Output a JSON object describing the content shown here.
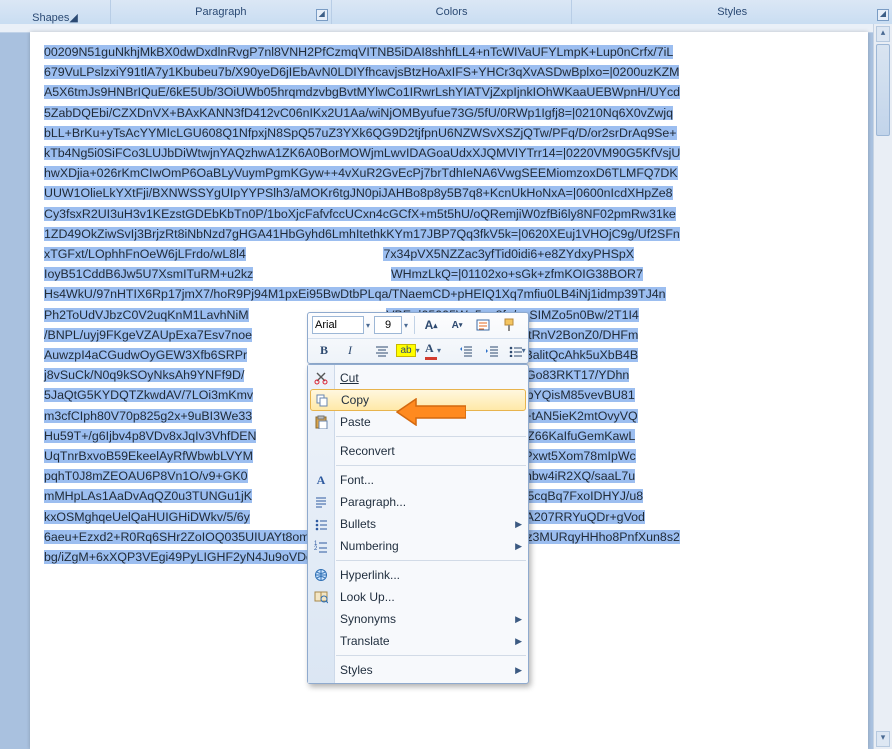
{
  "ribbon": {
    "group_left_partial": "Shapes",
    "group_paragraph": "Paragraph",
    "group_colors": "Colors",
    "group_styles": "Styles"
  },
  "mini_toolbar": {
    "font_name": "Arial",
    "font_size": "9",
    "grow_font": "A",
    "shrink_font": "A",
    "bold": "B",
    "italic": "I"
  },
  "context_menu": {
    "cut": "Cut",
    "copy": "Copy",
    "paste": "Paste",
    "reconvert": "Reconvert",
    "font": "Font...",
    "paragraph": "Paragraph...",
    "bullets": "Bullets",
    "numbering": "Numbering",
    "hyperlink": "Hyperlink...",
    "lookup": "Look Up...",
    "synonyms": "Synonyms",
    "translate": "Translate",
    "styles": "Styles"
  },
  "document_lines": [
    "00209N51guNkhjMkBX0dwDxdlnRvgP7nl8VNH2PfCzmqVITNB5iDAI8shhfLL4+nTcWIVaUFYLmpK+Lup0nCrfx/7iL",
    "679VuLPslzxiY91tlA7y1Kbubeu7b/X90yeD6jIEbAvN0LDIYfhcavjsBtzHoAxIFS+YHCr3qXvASDwBplxo=|0200uzKZM",
    "A5X6tmJs9HNBrIQuE/6kE5Ub/3OiUWb05hrqmdzvbgBvtMYlwCo1IRwrLshYIATVjZxpIjnkIOhWKaaUEBWpnH/UYcd",
    "5ZabDQEbi/CZXDnVX+BAxKANN3fD412vC06nIKx2U1Aa/wiNjOMByufue73G/5fU/0RWp1Igfj8=|0210Nq6X0vZwjq",
    "bLL+BrKu+yTsAcYYMIcLGU608Q1NfpxjN8SpQ57uZ3YXk6QG9D2tjfpnU6NZWSvXSZjQTw/PFq/D/or2srDrAq9Se+",
    "kTb4Ng5i0SiFCo3LUJbDiWtwjnYAQzhwA1ZK6A0BorMOWjmLwvIDAGoaUdxXJQMVIYTrr14=|0220VM90G5KfVsjU",
    "hwXDjia+026rKmCIwOmP6OaBLyVuymPgmKGyw++4vXuR2GvEcPj7brTdhIeNA6VwgSEEMiomzoxD6TLMFQ7DK",
    "UUW1OlieLkYXtFji/BXNWSSYgUIpYYPSlh3/aMOKr6tgJN0piJAHBo8p8y5B7q8+KcnUkHoNxA=|0600nIcdXHpZe8",
    "Cy3fsxR2UI3uH3v1KEzstGDEbKbTn0P/1boXjcFafvfccUCxn4cGCfX+m5t5hU/oQRemjiW0zfBi6ly8NF02pmRw31ke",
    "1ZD49OkZiwSvIj3BrjzRt8iNbNzd7gHGA41HbGyhd6LmhItethkKYm17JBP7Qq3fkV5k=|0620XEuj1VHOjC9g/Uf2SFn",
    "xTGFxt/LOphhFnOeW6jLFrdo/wL8l4{GAP}7x34pVX5NZZac3yfTid0idi6+e8ZYdxyPHSpX",
    "IoyB51CddB6Jw5U7XsmITuRM+u2kz{GAP}WHmzLkQ=|01102xo+sGk+zfmKOIG38BOR7",
    "Hs4WkU/97nHTIX6Rp17jmX7/hoR9Pj94M1pxEi95BwDtbPLqa/TNaemCD+pHEIQ1Xq7mfiu0LB4iNj1idmp39TJ4n",
    "Ph2ToUdVJbzC0V2uqKnM1LavhNiM{GAP}VBE=|05005W+5qg8fg/soSIMZo5n0Bw/2T1I4",
    "/BNPL/uyj9FKgeVZAUpExa7Esv7noe{GAP}jLv7yPbUx8I37jcPBrQ8HtRnV2BonZ0/DHFm",
    "AuwzpI4aCGudwOyGEW3Xfb6SRPr{GAP}JiY=|0800IAhH+UnnaXStBalitQcAhk5uXbB4B",
    "j8vSuCk/N0q9kSOyNksAh9YNFf9D/{GAP}grxwmU/NFHIrpW/WLFbhGo83RKT17/YDhn",
    "5JaQtG5KYDQTZkwdAV/7LOi3mKmv{GAP}=|0210ywTXSSZEICXhubYQisM85vevBU81",
    "m3cfCIph80V70p825g2x+9uBI3We33{GAP}dMfV5vM0tDS3FmVy0H+tAN5ieK2mtOvyVQ",
    "Hu59T+/g6Ijbv4p8VDv8xJqIv3VhfDEN{GAP}0220KqGBLG3aroaB3slZ66KaIfuGemKawL",
    "UqTnrBxvoB59EkeelAyRfWbwbLVYM{GAP}tbdoW6ywrHgo8d4C3zvPxwt5Xom78mIpWc",
    "pqhT0J8mZEOAU6P8Vn1O/v9+GK0{GAP}0700iNy4WjHsoGmFZUdhbw4iR2XQ/saaL7u",
    "mMHpLAs1AaDvAqQZ0u3TUNGu1jK{GAP}50tMcjqbBzhR6I3gTMLB5cqBq7FxoIDHYJ/u8",
    "kxOSMghqeUelQaHUIGHiDWkv/5/6y{GAP}06100wQgsR5pMfjD+CZA207RRYuQDr+gVod",
    "6aeu+Ezxd2+R0Rq6SHr2ZoIOQ035UIUAYt8omGXjAx5/AY4DUw4KgocCIy7X/e/Rbeaioz3MURqyHHho8PnfXun8s2",
    "bg/iZgM+6xXQP3VEgi49PyLIGHF2yN4Ju9oVDqfZB8hphWHsZQ="
  ]
}
